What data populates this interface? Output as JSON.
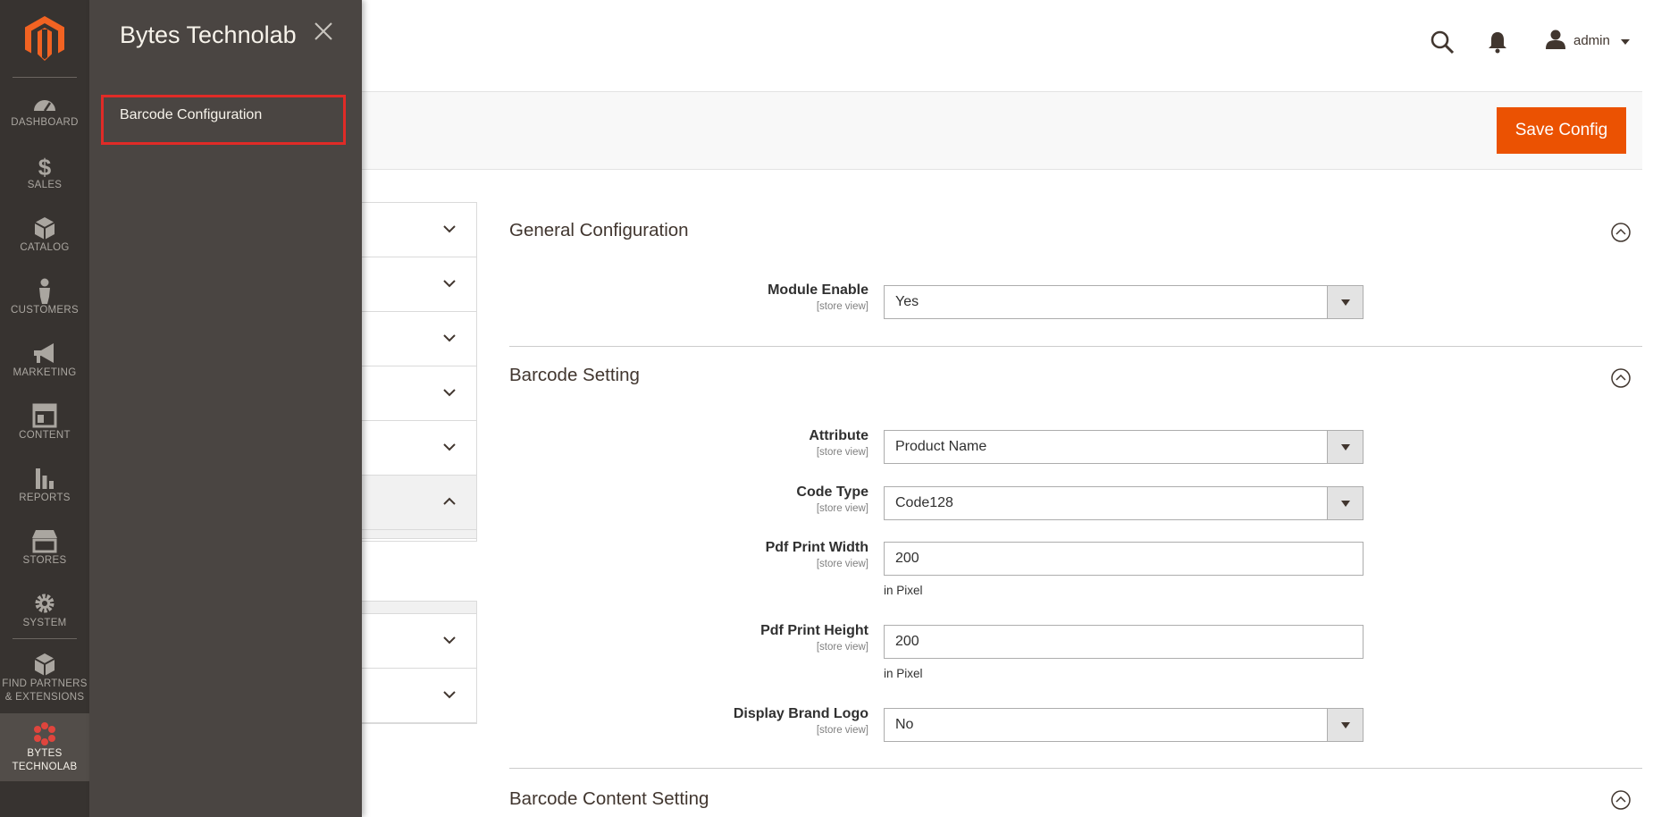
{
  "nav": {
    "items": [
      {
        "label": "DASHBOARD",
        "icon": "dashboard-icon"
      },
      {
        "label": "SALES",
        "icon": "dollar-icon"
      },
      {
        "label": "CATALOG",
        "icon": "box-icon"
      },
      {
        "label": "CUSTOMERS",
        "icon": "person-icon"
      },
      {
        "label": "MARKETING",
        "icon": "megaphone-icon"
      },
      {
        "label": "CONTENT",
        "icon": "layout-icon"
      },
      {
        "label": "REPORTS",
        "icon": "bar-chart-icon"
      },
      {
        "label": "STORES",
        "icon": "storefront-icon"
      },
      {
        "label": "SYSTEM",
        "icon": "gear-icon"
      },
      {
        "label_line1": "FIND PARTNERS",
        "label_line2": "& EXTENSIONS",
        "icon": "extensions-box-icon"
      },
      {
        "label_line1": "BYTES",
        "label_line2": "TECHNOLAB",
        "icon": "bytes-technolab-icon"
      }
    ]
  },
  "flyout": {
    "title": "Bytes Technolab",
    "link": "Barcode Configuration"
  },
  "header": {
    "user": "admin"
  },
  "actions": {
    "save_label": "Save Config"
  },
  "sections": {
    "general": {
      "title": "General Configuration"
    },
    "barcode": {
      "title": "Barcode Setting"
    },
    "content": {
      "title": "Barcode Content Setting"
    }
  },
  "fields": {
    "module_enable": {
      "label": "Module Enable",
      "scope": "[store view]",
      "value": "Yes"
    },
    "attribute": {
      "label": "Attribute",
      "scope": "[store view]",
      "value": "Product Name"
    },
    "code_type": {
      "label": "Code Type",
      "scope": "[store view]",
      "value": "Code128"
    },
    "pdf_width": {
      "label": "Pdf Print Width",
      "scope": "[store view]",
      "value": "200",
      "note": "in Pixel"
    },
    "pdf_height": {
      "label": "Pdf Print Height",
      "scope": "[store view]",
      "value": "200",
      "note": "in Pixel"
    },
    "brand_logo": {
      "label": "Display Brand Logo",
      "scope": "[store view]",
      "value": "No"
    }
  },
  "colors": {
    "accent": "#eb5202",
    "rail_bg": "#373330",
    "flyout_bg": "#4a4542",
    "highlight_border": "#e02b27"
  }
}
